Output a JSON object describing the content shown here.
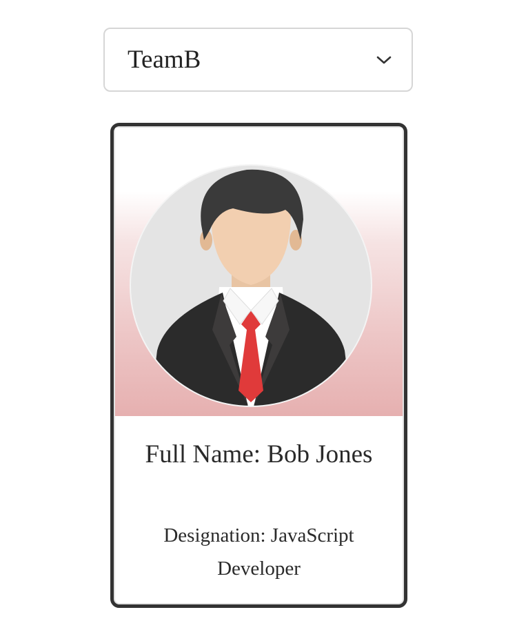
{
  "team_select": {
    "selected": "TeamB",
    "icon": "chevron-down-icon"
  },
  "profile_card": {
    "avatar_icon": "businessman-avatar-icon",
    "full_name": "Full Name: Bob Jones",
    "designation": "Designation: JavaScript Developer"
  },
  "colors": {
    "card_border": "#333333",
    "banner_gradient_bottom": "#e6b0b0",
    "tie": "#e03a3a",
    "suit": "#2b2b2b"
  }
}
